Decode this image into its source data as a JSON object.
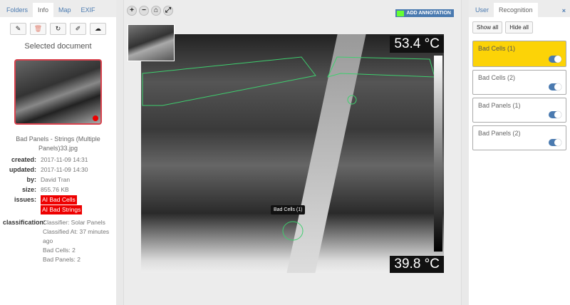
{
  "left": {
    "tabs": [
      "Folders",
      "Info",
      "Map",
      "EXIF"
    ],
    "active_tab": "Info",
    "tools": [
      "pencil-icon",
      "trash-icon",
      "refresh-icon",
      "pin-icon",
      "cloud-upload-icon"
    ],
    "title": "Selected document",
    "filename": "Bad Panels - Strings (Multiple Panels)33.jpg",
    "meta": {
      "created_label": "created:",
      "created": "2017-11-09 14:31",
      "updated_label": "updated:",
      "updated": "2017-11-09 14:30",
      "by_label": "by:",
      "by": "David Tran",
      "size_label": "size:",
      "size": "855.76 KB",
      "issues_label": "issues:",
      "issues": [
        "AI Bad Cells",
        "AI Bad Strings"
      ],
      "classification_label": "classification:",
      "classification": [
        "Classifier: Solar Panels",
        "Classified At: 37 minutes ago",
        "Bad Cells: 2",
        "Bad Panels: 2"
      ]
    }
  },
  "center": {
    "zoom_buttons": [
      "+",
      "−",
      "⌂",
      "⤢"
    ],
    "add_annotation": "ADD ANNOTATION",
    "temp_max": "53.4 °C",
    "temp_min": "39.8 °C",
    "annotation_label": "Bad Cells (1)",
    "colors": {
      "annotation": "#3ecf6e",
      "accent": "#4a7ab0"
    }
  },
  "right": {
    "tabs": [
      "User",
      "Recognition"
    ],
    "active_tab": "Recognition",
    "close": "×",
    "show_all": "Show all",
    "hide_all": "Hide all",
    "items": [
      {
        "label": "Bad Cells (1)",
        "on": true,
        "selected": true
      },
      {
        "label": "Bad Cells (2)",
        "on": true
      },
      {
        "label": "Bad Panels (1)",
        "on": true
      },
      {
        "label": "Bad Panels (2)",
        "on": true
      }
    ]
  }
}
